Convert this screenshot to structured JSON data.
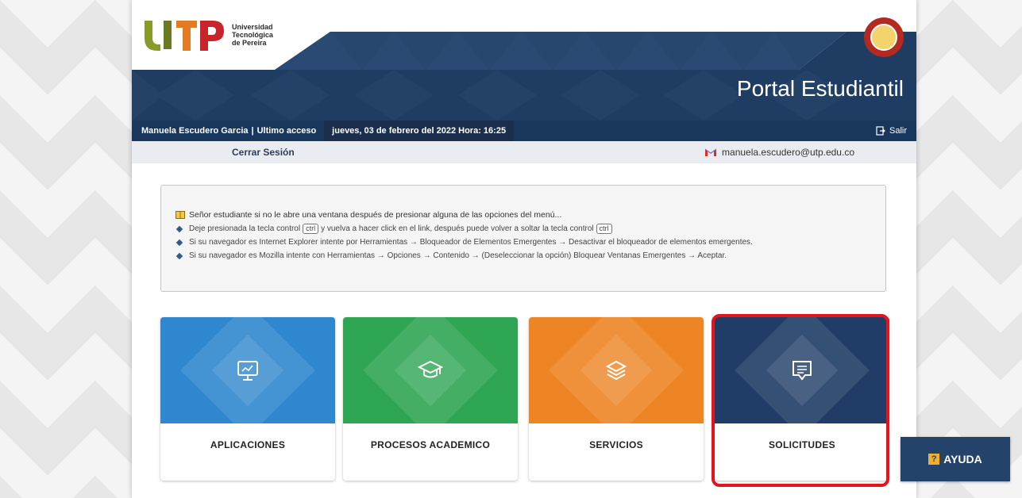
{
  "header": {
    "logo_line1": "Universidad",
    "logo_line2": "Tecnológica",
    "logo_line3": "de Pereira",
    "portal_title": "Portal Estudiantil"
  },
  "userbar": {
    "user_name": "Manuela Escudero Garcia",
    "separator": "|",
    "last_access_label": "Ultimo acceso",
    "last_access_date": "jueves, 03 de febrero del 2022 Hora: 16:25",
    "logout_label": "Salir"
  },
  "subbar": {
    "close_session": "Cerrar Sesión",
    "email": "manuela.escudero@utp.edu.co"
  },
  "notice": {
    "heading": "Señor estudiante si no le abre una ventana después de presionar alguna de las opciones del menú...",
    "line1_a": "Deje presionada la tecla control",
    "line1_key": "ctrl",
    "line1_b": "y vuelva a hacer click en el link, después puede volver a soltar la tecla control",
    "line1_key2": "ctrl",
    "line2": "Si su navegador es Internet Explorer intente por Herramientas → Bloqueador de Elementos Emergentes → Desactivar el bloqueador de elementos emergentes.",
    "line3": "Si su navegador es Mozilla intente con Herramientas → Opciones → Contenido → (Deseleccionar la opción) Bloquear Ventanas Emergentes → Aceptar."
  },
  "cards": [
    {
      "label": "APLICACIONES",
      "color": "#2f87cf"
    },
    {
      "label": "PROCESOS ACADEMICO",
      "color": "#2ea553"
    },
    {
      "label": "SERVICIOS",
      "color": "#ee8525"
    },
    {
      "label": "SOLICITUDES",
      "color": "#1f3d66"
    }
  ],
  "help": {
    "label": "AYUDA",
    "icon_text": "?"
  },
  "colors": {
    "banner": "#1f3c63",
    "highlight": "#e3141d"
  }
}
